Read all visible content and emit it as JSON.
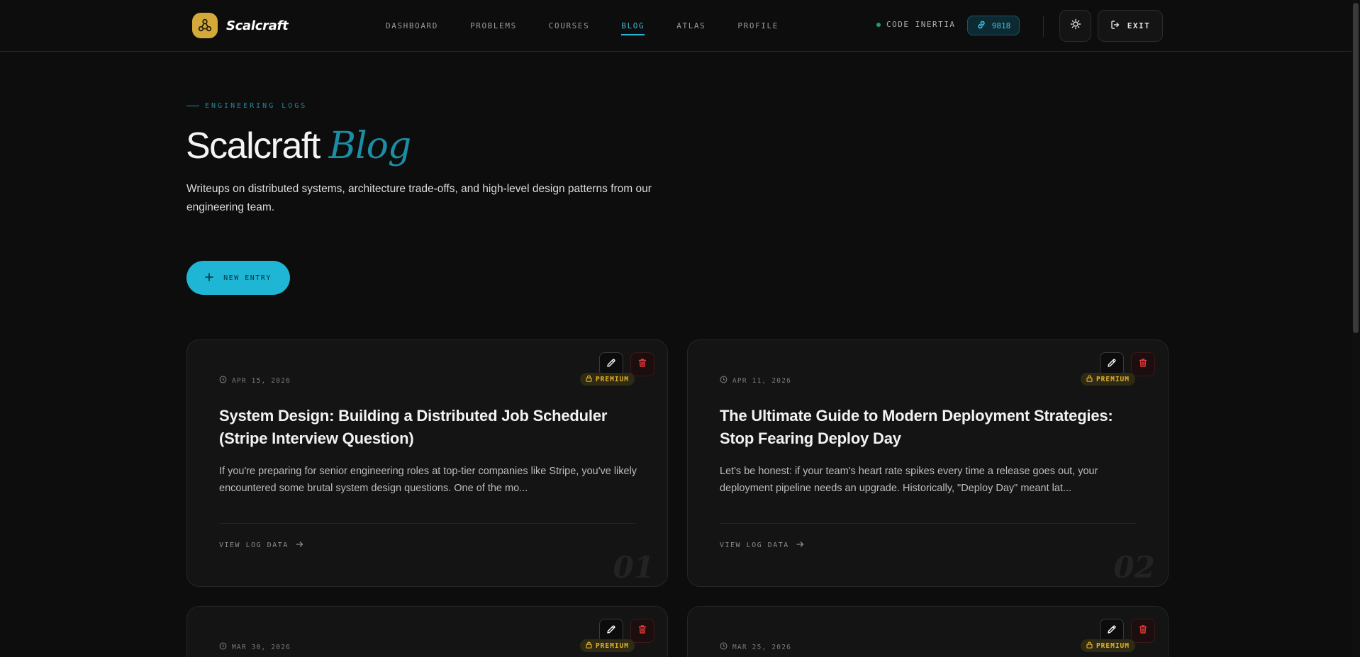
{
  "brand": {
    "name": "Scalcraft"
  },
  "nav": [
    {
      "label": "DASHBOARD",
      "active": false
    },
    {
      "label": "PROBLEMS",
      "active": false
    },
    {
      "label": "COURSES",
      "active": false
    },
    {
      "label": "BLOG",
      "active": true
    },
    {
      "label": "ATLAS",
      "active": false
    },
    {
      "label": "PROFILE",
      "active": false
    }
  ],
  "status": {
    "label": "CODE INERTIA",
    "color": "#1f9d6a"
  },
  "points": {
    "value": "9818",
    "icon": "link-icon"
  },
  "header_actions": {
    "theme_icon": "sun-icon",
    "exit_label": "EXIT",
    "exit_icon": "logout-icon"
  },
  "hero": {
    "eyebrow": "ENGINEERING LOGS",
    "title_main": "Scalcraft",
    "title_accent": "Blog",
    "description": "Writeups on distributed systems, architecture trade-offs, and high-level design patterns from our engineering team.",
    "new_entry_label": "NEW ENTRY"
  },
  "posts": [
    {
      "date": "APR 15, 2026",
      "badge": "PREMIUM",
      "title": "System Design: Building a Distributed Job Scheduler (Stripe Interview Question)",
      "excerpt": "If you're preparing for senior engineering roles at top-tier companies like Stripe, you've likely encountered some brutal system design questions. One of the mo...",
      "link_label": "VIEW LOG DATA",
      "index": "01"
    },
    {
      "date": "APR 11, 2026",
      "badge": "PREMIUM",
      "title": "The Ultimate Guide to Modern Deployment Strategies: Stop Fearing Deploy Day",
      "excerpt": "Let's be honest: if your team's heart rate spikes every time a release goes out, your deployment pipeline needs an upgrade. Historically, \"Deploy Day\" meant lat...",
      "link_label": "VIEW LOG DATA",
      "index": "02"
    },
    {
      "date": "MAR 30, 2026",
      "badge": "PREMIUM"
    },
    {
      "date": "MAR 25, 2026",
      "badge": "PREMIUM"
    }
  ],
  "colors": {
    "accent": "#1fb6d6",
    "premium": "#e2b12c",
    "danger": "#e03a3a",
    "background": "#0d0d0d"
  }
}
